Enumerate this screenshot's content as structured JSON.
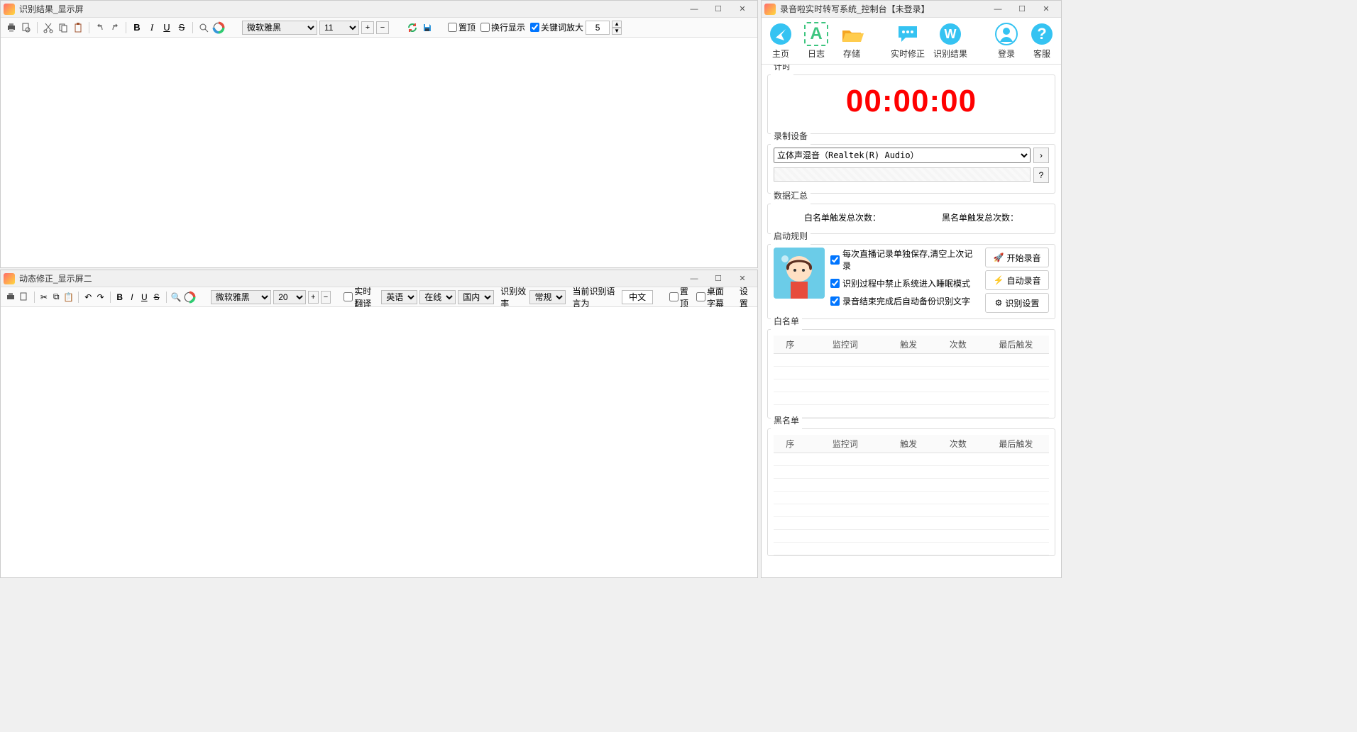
{
  "windows": {
    "result": {
      "title": "识别结果_显示屏"
    },
    "correction": {
      "title": "动态修正_显示屏二"
    },
    "control": {
      "title": "录音啦实时转写系统_控制台【未登录】"
    }
  },
  "toolbar1": {
    "font": "微软雅黑",
    "fontSize": "11",
    "checkboxes": {
      "topmost": "置顶",
      "wrap": "换行显示",
      "keyword_zoom": "关键词放大"
    },
    "spin_value": "5"
  },
  "toolbar2": {
    "font": "微软雅黑",
    "fontSize": "20",
    "chk_translate": "实时翻译",
    "lang": "英语",
    "mode": "在线",
    "region": "国内",
    "label_efficiency": "识别效率",
    "efficiency": "常规",
    "label_current_lang": "当前识别语言为",
    "current_lang": "中文",
    "chk_topmost": "置顶",
    "chk_desktop_sub": "桌面字幕",
    "settings": "设置"
  },
  "rp_tools": {
    "home": "主页",
    "log": "日志",
    "storage": "存储",
    "live_correct": "实时修正",
    "recog_result": "识别结果",
    "login": "登录",
    "support": "客服"
  },
  "rp": {
    "timer_label": "计时",
    "timer_value": "00:00:00",
    "device_label": "录制设备",
    "device_value": "立体声混音（Realtek(R) Audio）",
    "summary_label": "数据汇总",
    "white_total": "白名单触发总次数：",
    "black_total": "黑名单触发总次数：",
    "rules_label": "启动规则",
    "rule1": "每次直播记录单独保存,清空上次记录",
    "rule2": "识别过程中禁止系统进入睡眠模式",
    "rule3": "录音结束完成后自动备份识别文字",
    "btn_start": "开始录音",
    "btn_auto": "自动录音",
    "btn_settings": "识别设置",
    "whitelist_label": "白名单",
    "blacklist_label": "黑名单",
    "cols": {
      "seq": "序",
      "keyword": "监控词",
      "trigger": "触发",
      "count": "次数",
      "last": "最后触发"
    }
  }
}
